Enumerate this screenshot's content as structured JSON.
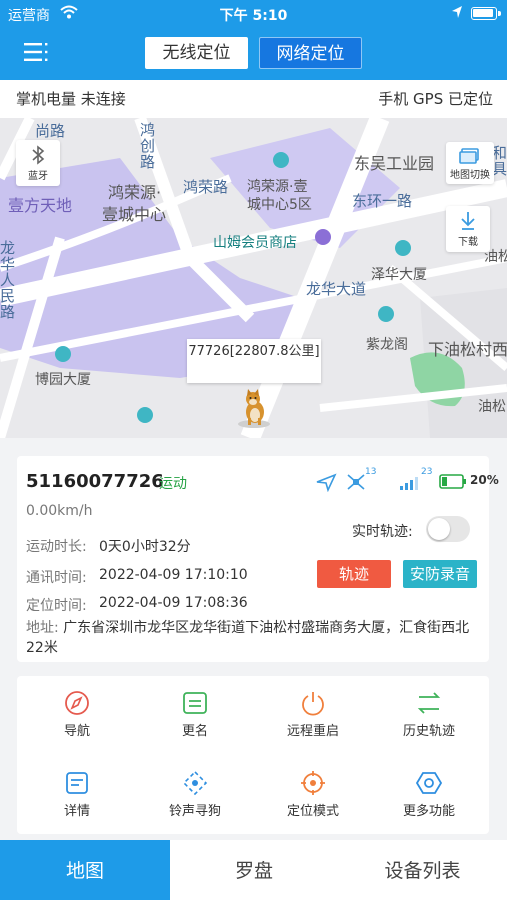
{
  "status_bar": {
    "carrier": "运营商",
    "time": "下午 5:10"
  },
  "header": {
    "mode_tabs": [
      {
        "label": "无线定位",
        "active": false
      },
      {
        "label": "网络定位",
        "active": true
      }
    ],
    "brand_color": "#1e9be8"
  },
  "info_bar": {
    "left": "掌机电量 未连接",
    "right": "手机 GPS 已定位"
  },
  "map": {
    "buttons": {
      "bluetooth": "蓝牙",
      "map_switch": "地图切换",
      "download": "下载"
    },
    "labels": {
      "l1": "尚路",
      "l2": "鸿创路",
      "l3": "鸿荣源·",
      "l4": "壹城中心",
      "l5": "鸿荣路",
      "l6": "鸿荣源·壹",
      "l7": "城中心5区",
      "l8": "东吴工业园",
      "l9": "壹方天地",
      "l10": "东环一路",
      "l11": "和",
      "l12": "具",
      "l13": "山姆会员商店",
      "l14": "泽华大厦",
      "l15": "油松",
      "l16": "龙华人民路",
      "l17": "龙华大道",
      "l18": "紫龙阁",
      "l19": "下油松村西",
      "l20": "博园大厦",
      "l21": "油松"
    },
    "marker_popup": "77726[22807.8公里]"
  },
  "device": {
    "imei": "51160077726",
    "status": "运动",
    "signal_a": "13",
    "signal_b": "23",
    "battery": "20%",
    "speed": "0.00km/h",
    "realtime_label": "实时轨迹:",
    "realtime_on": false,
    "rows": [
      {
        "label": "运动时长:",
        "value": "0天0小时32分"
      },
      {
        "label": "通讯时间:",
        "value": "2022-04-09 17:10:10"
      },
      {
        "label": "定位时间:",
        "value": "2022-04-09 17:08:36"
      }
    ],
    "btn_track": "轨迹",
    "btn_security": "安防录音",
    "address_label": "地址:",
    "address": "广东省深圳市龙华区龙华街道下油松村盛瑞商务大厦，汇食街西北22米"
  },
  "functions": [
    {
      "label": "导航",
      "icon": "navigate-icon",
      "color": "#e55a4e"
    },
    {
      "label": "更名",
      "icon": "rename-icon",
      "color": "#3fb35a"
    },
    {
      "label": "远程重启",
      "icon": "power-icon",
      "color": "#f07f3c"
    },
    {
      "label": "历史轨迹",
      "icon": "history-track-icon",
      "color": "#3fb35a"
    },
    {
      "label": "详情",
      "icon": "details-icon",
      "color": "#2f8fe0"
    },
    {
      "label": "铃声寻狗",
      "icon": "ring-find-icon",
      "color": "#2f8fe0"
    },
    {
      "label": "定位模式",
      "icon": "crosshair-icon",
      "color": "#f07f3c"
    },
    {
      "label": "更多功能",
      "icon": "more-hex-icon",
      "color": "#2f8fe0"
    }
  ],
  "tabs": [
    {
      "label": "地图",
      "active": true
    },
    {
      "label": "罗盘",
      "active": false
    },
    {
      "label": "设备列表",
      "active": false
    }
  ]
}
